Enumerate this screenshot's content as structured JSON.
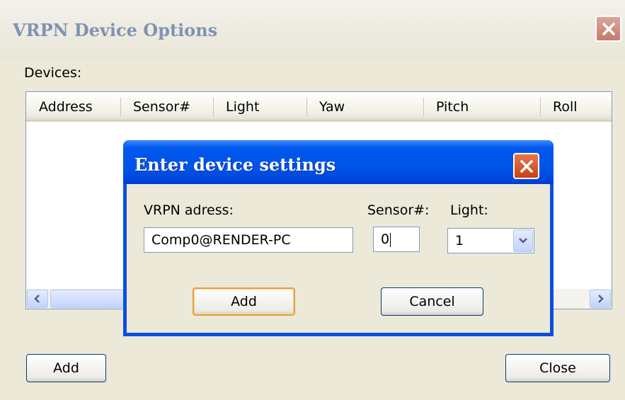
{
  "window": {
    "title": "VRPN Device Options"
  },
  "devices": {
    "label": "Devices:",
    "columns": [
      "Address",
      "Sensor#",
      "Light",
      "Yaw",
      "Pitch",
      "Roll"
    ]
  },
  "buttons": {
    "add": "Add",
    "close": "Close"
  },
  "dialog": {
    "title": "Enter device settings",
    "address_label": "VRPN adress:",
    "sensor_label": "Sensor#:",
    "light_label": "Light:",
    "address_value": "Comp0@RENDER-PC",
    "sensor_value": "0",
    "light_value": "1",
    "add_label": "Add",
    "cancel_label": "Cancel"
  },
  "colors": {
    "titlebar_active": "#0052e6",
    "window_bg": "#ece9d8",
    "close_button": "#c64215"
  },
  "icons": {
    "window_close": "close-icon",
    "scroll_left": "arrow-left-icon",
    "scroll_right": "arrow-right-icon",
    "dropdown": "chevron-down-icon"
  }
}
